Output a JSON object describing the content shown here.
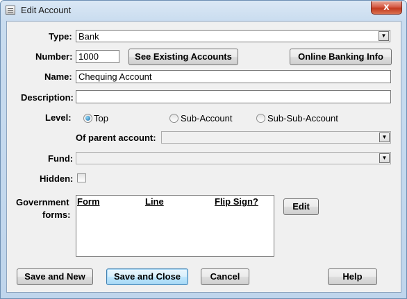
{
  "window": {
    "title": "Edit Account",
    "close_glyph": "x",
    "icon": "app-icon"
  },
  "form": {
    "type_label": "Type:",
    "type_value": "Bank",
    "number_label": "Number:",
    "number_value": "1000",
    "see_existing_label": "See Existing Accounts",
    "online_banking_label": "Online Banking Info",
    "name_label": "Name:",
    "name_value": "Chequing Account",
    "description_label": "Description:",
    "description_value": "",
    "level_label": "Level:",
    "level_options": [
      "Top",
      "Sub-Account",
      "Sub-Sub-Account"
    ],
    "level_selected": "Top",
    "parent_label": "Of parent account:",
    "parent_value": "",
    "fund_label": "Fund:",
    "fund_value": "",
    "hidden_label": "Hidden:",
    "hidden_checked": false,
    "gov_label_line1": "Government",
    "gov_label_line2": "forms:",
    "gov_columns": [
      "Form",
      "Line",
      "Flip Sign?"
    ],
    "gov_rows": [],
    "edit_label": "Edit"
  },
  "footer": {
    "save_new_label": "Save and New",
    "save_close_label": "Save and Close",
    "cancel_label": "Cancel",
    "help_label": "Help"
  }
}
